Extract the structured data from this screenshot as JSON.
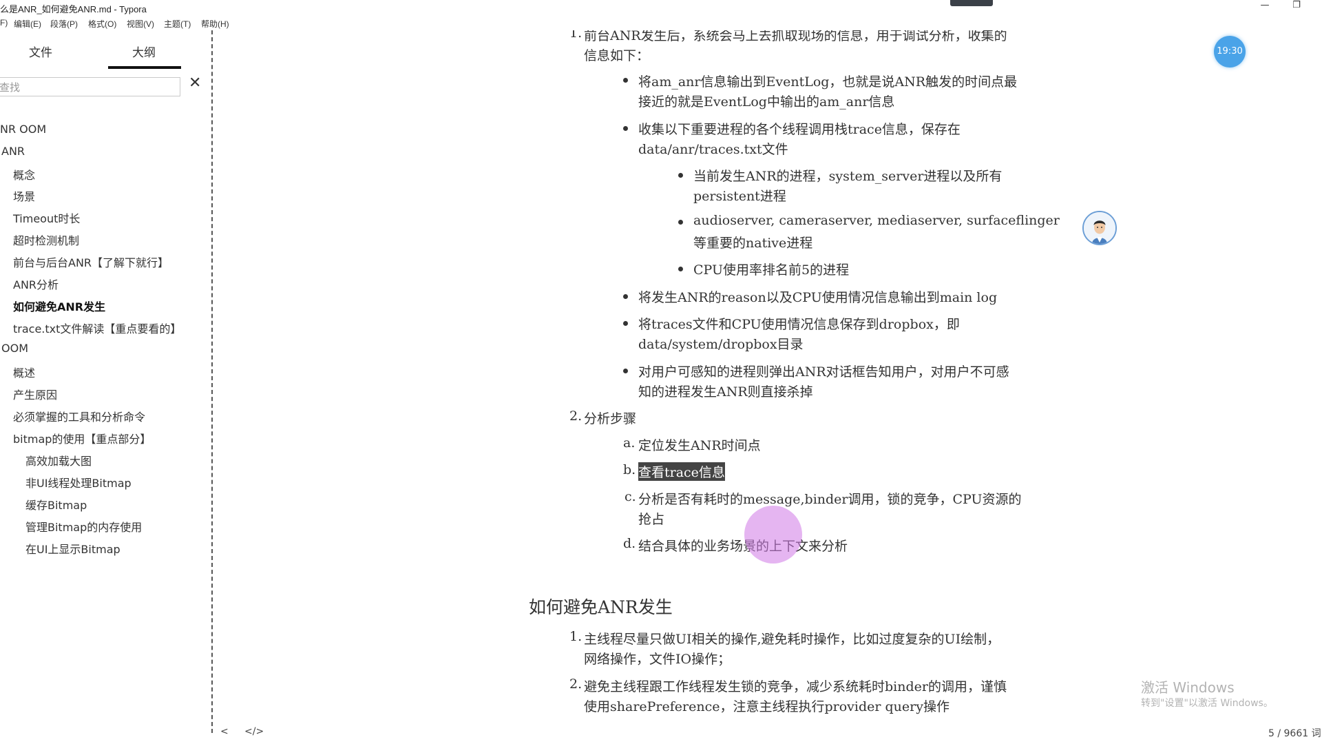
{
  "window": {
    "title": "么是ANR_如何避免ANR.md - Typora",
    "minimize_glyph": "—",
    "restore_glyph": "❐"
  },
  "menu": [
    "F)",
    "编辑(E)",
    "段落(P)",
    "格式(O)",
    "视图(V)",
    "主题(T)",
    "帮助(H)"
  ],
  "sidebar": {
    "tabs": [
      "文件",
      "大纲"
    ],
    "active_tab": "大纲",
    "search_placeholder": "查找",
    "close_glyph": "✕",
    "outline": [
      {
        "label": "NR OOM",
        "level": 0
      },
      {
        "label": "ANR",
        "level": 0
      },
      {
        "label": "概念",
        "level": 1
      },
      {
        "label": "场景",
        "level": 1
      },
      {
        "label": "Timeout时长",
        "level": 1
      },
      {
        "label": "超时检测机制",
        "level": 1
      },
      {
        "label": "前台与后台ANR【了解下就行】",
        "level": 1
      },
      {
        "label": "ANR分析",
        "level": 1
      },
      {
        "label": "如何避免ANR发生",
        "level": 1,
        "active": true
      },
      {
        "label": "trace.txt文件解读【重点要看的】",
        "level": 1
      },
      {
        "label": "OOM",
        "level": 0
      },
      {
        "label": "概述",
        "level": 1
      },
      {
        "label": "产生原因",
        "level": 1
      },
      {
        "label": "必须掌握的工具和分析命令",
        "level": 1
      },
      {
        "label": "bitmap的使用【重点部分】",
        "level": 1
      },
      {
        "label": "高效加载大图",
        "level": 2
      },
      {
        "label": "非UI线程处理Bitmap",
        "level": 2
      },
      {
        "label": "缓存Bitmap",
        "level": 2
      },
      {
        "label": "管理Bitmap的内存使用",
        "level": 2
      },
      {
        "label": "在UI上显示Bitmap",
        "level": 2
      }
    ]
  },
  "editor": {
    "item1": {
      "number": "1.",
      "line1": "前台ANR发生后，系统会马上去抓取现场的信息，用于调试分析，收集的",
      "line2": "信息如下：",
      "bullets": [
        {
          "line1": "将am_anr信息输出到EventLog，也就是说ANR触发的时间点最",
          "line2": "接近的就是EventLog中输出的am_anr信息"
        },
        {
          "line1": "收集以下重要进程的各个线程调用栈trace信息，保存在",
          "line2": "data/anr/traces.txt文件"
        }
      ],
      "sub_bullets": [
        {
          "line1": "当前发生ANR的进程，system_server进程以及所有",
          "line2": "persistent进程"
        },
        {
          "line1": "audioserver, cameraserver, mediaserver, surfaceflinger",
          "line2": "等重要的native进程"
        },
        {
          "line1": "CPU使用率排名前5的进程",
          "line2": ""
        }
      ],
      "bullets2": [
        {
          "line1": "将发生ANR的reason以及CPU使用情况信息输出到main log",
          "line2": ""
        },
        {
          "line1": "将traces文件和CPU使用情况信息保存到dropbox，即",
          "line2": "data/system/dropbox目录"
        },
        {
          "line1": "对用户可感知的进程则弹出ANR对话框告知用户，对用户不可感",
          "line2": "知的进程发生ANR则直接杀掉"
        }
      ]
    },
    "item2": {
      "number": "2.",
      "title": "分析步骤",
      "steps": [
        {
          "marker": "a.",
          "line1": "定位发生ANR时间点",
          "line2": ""
        },
        {
          "marker": "b.",
          "line1": "查看trace信息",
          "line2": "",
          "selected": true
        },
        {
          "marker": "c.",
          "line1": "分析是否有耗时的message,binder调用，锁的竞争，CPU资源的",
          "line2": "抢占"
        },
        {
          "marker": "d.",
          "line1": "结合具体的业务场景的上下文来分析",
          "line2": ""
        }
      ]
    },
    "heading": "如何避免ANR发生",
    "avoid": [
      {
        "number": "1.",
        "line1": "主线程尽量只做UI相关的操作,避免耗时操作，比如过度复杂的UI绘制，",
        "line2": "网络操作，文件IO操作；"
      },
      {
        "number": "2.",
        "line1": "避免主线程跟工作线程发生锁的竞争，减少系统耗时binder的调用，谨慎",
        "line2": "使用sharePreference，注意主线程执行provider query操作"
      }
    ]
  },
  "overlay": {
    "clock": "19:30",
    "watermark_line1": "激活 Windows",
    "watermark_line2": "转到\"设置\"以激活 Windows。"
  },
  "footer": {
    "back_glyph": "<",
    "source_glyph": "</>",
    "word_count": "5 / 9661 词"
  }
}
